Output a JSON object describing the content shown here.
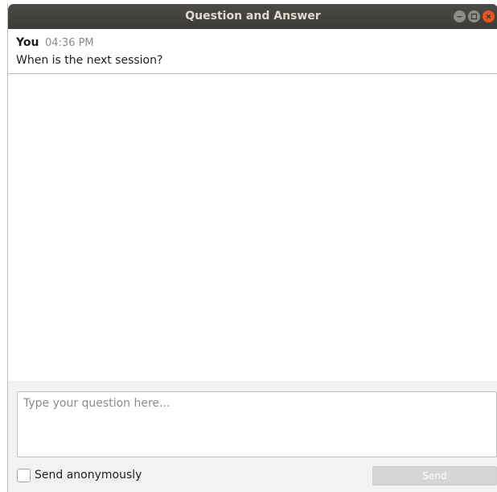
{
  "window": {
    "title": "Question and Answer"
  },
  "messages": [
    {
      "sender": "You",
      "time": "04:36 PM",
      "text": "When is the next session?"
    }
  ],
  "composer": {
    "placeholder": "Type your question here...",
    "anonymous_label": "Send anonymously",
    "anonymous_checked": false,
    "send_label": "Send"
  },
  "colors": {
    "titlebar": "#3c3b37",
    "close_button": "#e95420",
    "composer_background": "#f2f2f1",
    "send_disabled": "#d6d6d4"
  },
  "icons": {
    "minimize": "minimize-icon",
    "maximize": "maximize-icon",
    "close": "close-icon"
  }
}
